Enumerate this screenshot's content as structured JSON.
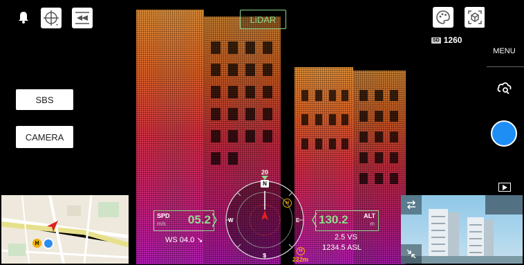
{
  "top_left": {
    "bell_icon": "bell-icon",
    "gimbal_icon": "gimbal-icon",
    "flight_mode_icon": "flight-mode-icon"
  },
  "mode_chip": "LiDAR",
  "top_right": {
    "palette_icon": "palette-icon",
    "cube_icon": "cube-icon",
    "sd_label": "SD",
    "sd_count": "1260"
  },
  "right_panel": {
    "menu_label": "MENU",
    "play_icon": "play-icon"
  },
  "left_buttons": {
    "sbs": "SBS",
    "camera": "CAMERA"
  },
  "hud": {
    "spd_label": "SPD",
    "spd_unit": "m/s",
    "spd_value": "05.2",
    "ws_text": "WS 04.0 ↘",
    "alt_label": "ALT",
    "alt_unit": "m",
    "alt_value": "130.2",
    "vs_text": "2.5 VS",
    "asl_text": "1234.5 ASL",
    "heading_value": "20",
    "north": "N",
    "east": "E",
    "south": "S",
    "west": "W",
    "home_marker": "H",
    "home_distance": "222m"
  },
  "colors": {
    "accent_green": "#8fdc8f",
    "shutter_blue": "#1e8ef5",
    "home_yellow": "#f0b000",
    "aircraft_red": "#e02020"
  }
}
